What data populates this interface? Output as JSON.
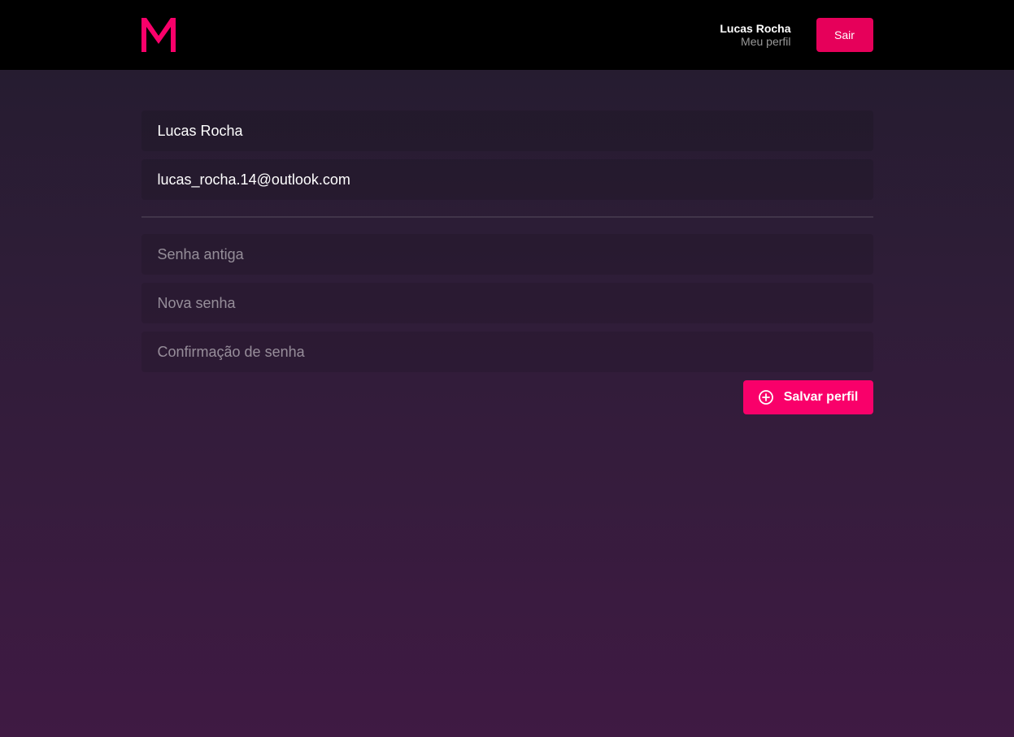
{
  "header": {
    "logo_icon": "m-logo-icon",
    "profile_name": "Lucas Rocha",
    "profile_link": "Meu perfil",
    "logout_label": "Sair"
  },
  "form": {
    "name_value": "Lucas Rocha",
    "email_value": "lucas_rocha.14@outlook.com",
    "old_password_placeholder": "Senha antiga",
    "new_password_placeholder": "Nova senha",
    "confirm_password_placeholder": "Confirmação de senha",
    "save_label": "Salvar perfil",
    "save_icon": "add-circle-icon"
  },
  "colors": {
    "accent": "#f9006a",
    "header_bg": "#000000",
    "bg_top": "#231c2e",
    "bg_bottom": "#3f1a43"
  }
}
